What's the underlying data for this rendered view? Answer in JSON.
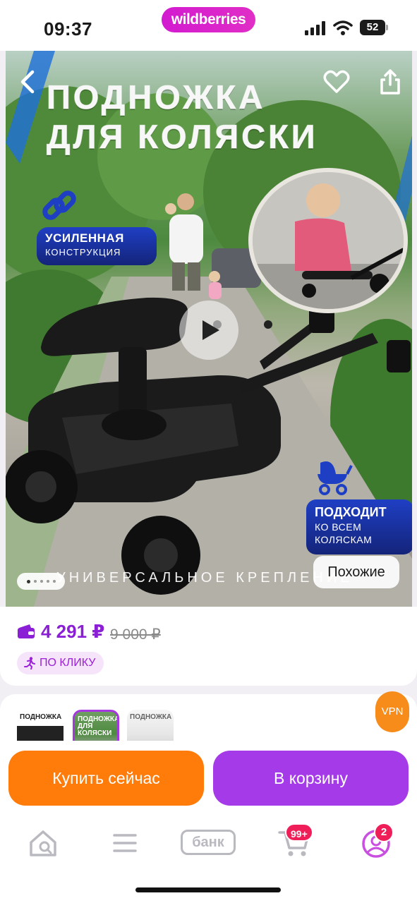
{
  "status_bar": {
    "time": "09:37",
    "brand": "wildberries",
    "battery": "52",
    "icons": [
      "signal-icon",
      "wifi-icon",
      "battery-icon"
    ]
  },
  "hero": {
    "title_line1": "ПОДНОЖКА",
    "title_line2": "ДЛЯ КОЛЯСКИ",
    "badge_strong_title": "УСИЛЕННАЯ",
    "badge_strong_sub": "КОНСТРУКЦИЯ",
    "badge_fits_title": "ПОДХОДИТ",
    "badge_fits_line2": "КО ВСЕМ",
    "badge_fits_line3": "КОЛЯСКАМ",
    "caption": "УНИВЕРСАЛЬНОЕ КРЕПЛЕНИЕ",
    "similar_label": "Похожие",
    "icons": [
      "back-icon",
      "heart-icon",
      "share-icon",
      "chain-icon",
      "stroller-icon",
      "play-icon"
    ],
    "colors": {
      "badge_blue": "#1f3fc4"
    }
  },
  "price_card": {
    "price": "4 291 ₽",
    "old_price": "9 000 ₽",
    "tag": "ПО КЛИКУ",
    "colors": {
      "price": "#8b1fd6",
      "tag_bg": "#f6e4fb"
    }
  },
  "thumbnails": [
    {
      "label": "ПОДНОЖКА"
    },
    {
      "label": "ПОДНОЖКА ДЛЯ КОЛЯСКИ"
    },
    {
      "label": "ПОДНОЖКА"
    }
  ],
  "vpn_label": "VPN",
  "actions": {
    "buy_now": "Купить сейчас",
    "add_to_cart": "В корзину",
    "colors": {
      "buy_now": "#ff7b0a",
      "add_to_cart": "#a53ae8"
    }
  },
  "bottom_nav": {
    "bank_label": "банк",
    "cart_badge": "99+",
    "profile_badge": "2",
    "icons": [
      "home-search-icon",
      "catalog-icon",
      "bank-icon",
      "cart-icon",
      "profile-icon"
    ]
  }
}
